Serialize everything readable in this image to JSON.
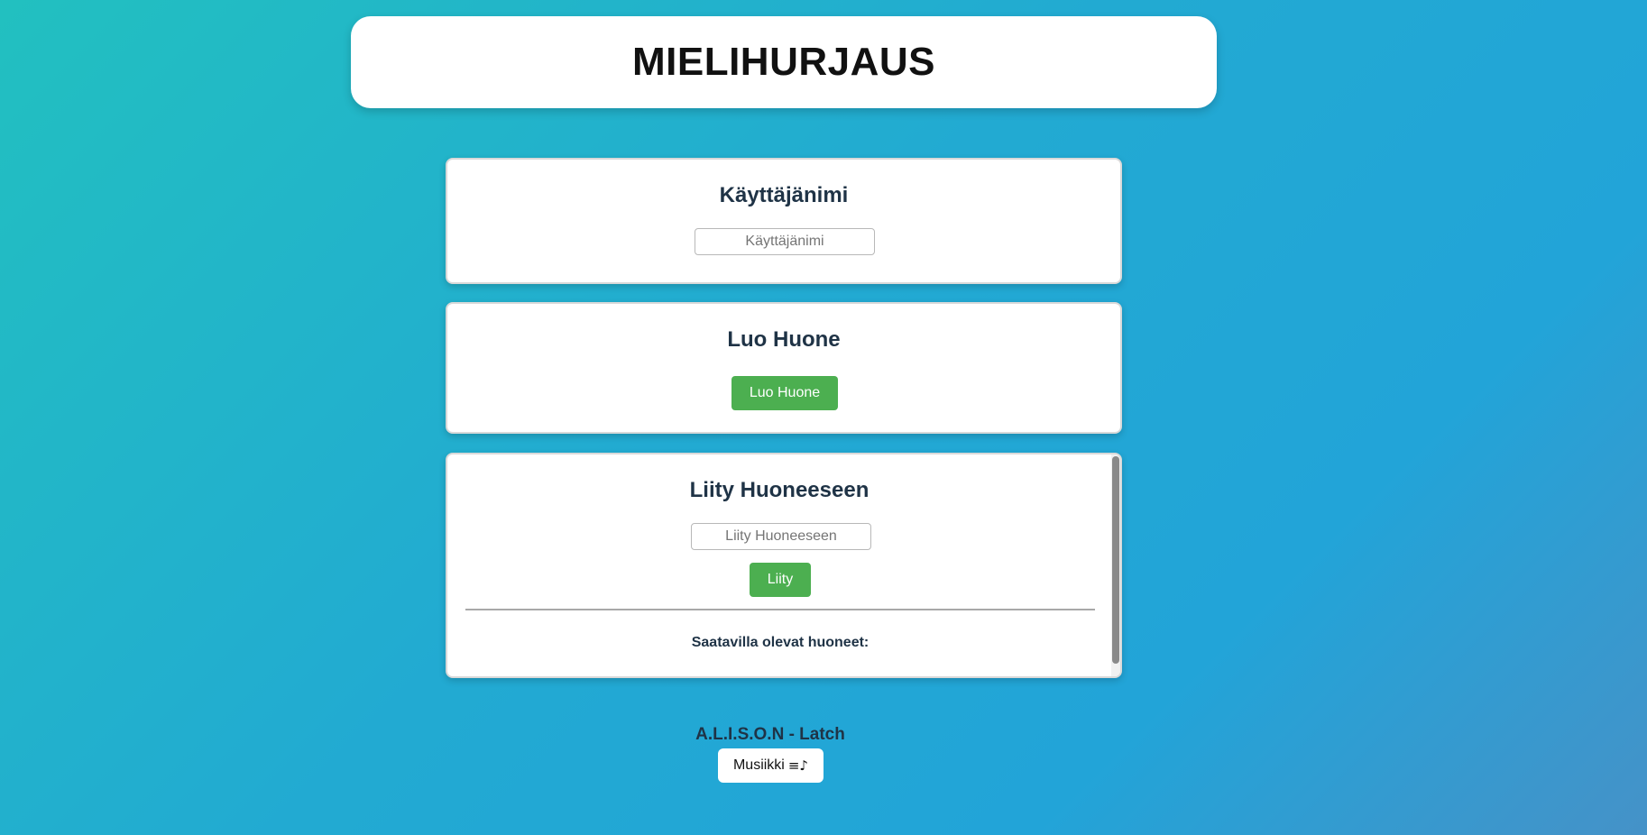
{
  "header": {
    "title": "MIELIHURJAUS"
  },
  "username_card": {
    "heading": "Käyttäjänimi",
    "input_placeholder": "Käyttäjänimi",
    "input_value": ""
  },
  "create_card": {
    "heading": "Luo Huone",
    "button_label": "Luo Huone"
  },
  "join_card": {
    "heading": "Liity Huoneeseen",
    "input_placeholder": "Liity Huoneeseen",
    "input_value": "",
    "button_label": "Liity",
    "rooms_label": "Saatavilla olevat huoneet:",
    "rooms": []
  },
  "music": {
    "song_title": "A.L.I.S.O.N - Latch",
    "button_label": "Musiikki",
    "button_icon": "music-list-icon",
    "button_icon_glyph": "≡♪"
  },
  "colors": {
    "accent_green": "#4caf50",
    "heading_text": "#1f3346",
    "background_start": "#22c0c0",
    "background_end": "#4592c8"
  }
}
